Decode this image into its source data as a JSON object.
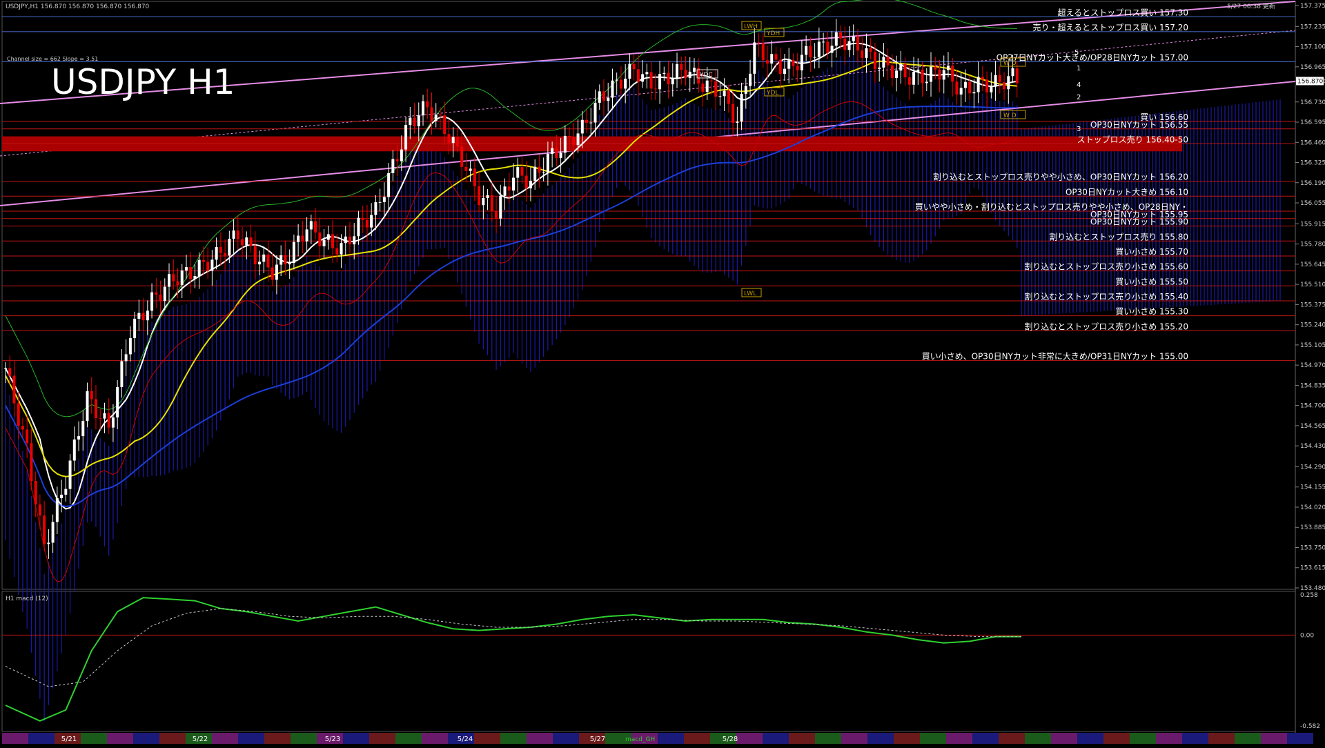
{
  "header": {
    "symbol_info": "USDJPY,H1  156.870 156.870 156.870 156.870",
    "updated": "5/27 06:38 更新",
    "channel_info": "Channel size = 662 Slope = 3.51",
    "big_title": "USDJPY H1",
    "macd_label": "H1  macd (12)",
    "macd_tab": "macd_GH"
  },
  "markers": {
    "lwh": "LWH",
    "lwl": "LWL",
    "ydh": "YDH",
    "ydl": "YDL",
    "ydc": "YDC",
    "wd_top": "W D",
    "wd_bot": "W D",
    "ch1": "1",
    "ch2": "2",
    "ch3": "3",
    "ch4": "4",
    "ch5": "5"
  },
  "chart_data": {
    "type": "candlestick",
    "symbol": "USDJPY",
    "timeframe": "H1",
    "last_price": 156.87,
    "y_axis_ticks": [
      "157.375",
      "157.235",
      "157.100",
      "156.965",
      "156.870",
      "156.730",
      "156.595",
      "156.460",
      "156.325",
      "156.190",
      "156.055",
      "155.915",
      "155.780",
      "155.645",
      "155.510",
      "155.375",
      "155.240",
      "155.105",
      "154.970",
      "154.835",
      "154.700",
      "154.565",
      "154.430",
      "154.290",
      "154.155",
      "154.020",
      "153.885",
      "153.750",
      "153.615",
      "153.480"
    ],
    "ylim": [
      153.48,
      157.375
    ],
    "date_labels": [
      "5/21",
      "5/22",
      "5/23",
      "5/24",
      "5/27",
      "5/28"
    ],
    "levels": [
      {
        "price": 157.3,
        "label": "超えるとストップロス買い 157.30"
      },
      {
        "price": 157.2,
        "label": "売り・超えるとストップロス買い 157.20"
      },
      {
        "price": 157.0,
        "label": "OP27日NYカット大きめ/OP28日NYカット 157.00"
      },
      {
        "price": 156.6,
        "label": "買い 156.60"
      },
      {
        "price": 156.55,
        "label": "OP30日NYカット 156.55"
      },
      {
        "price": 156.45,
        "label": "ストップロス売り 156.40-50"
      },
      {
        "price": 156.2,
        "label": "割り込むとストップロス売りやや小さめ、OP30日NYカット 156.20"
      },
      {
        "price": 156.1,
        "label": "OP30日NYカット大きめ 156.10"
      },
      {
        "price": 156.0,
        "label": "買いやや小さめ・割り込むとストップロス売りやや小さめ、OP28日NY・"
      },
      {
        "price": 155.95,
        "label": "OP30日NYカット 155.95"
      },
      {
        "price": 155.9,
        "label": "OP30日NYカット 155.90"
      },
      {
        "price": 155.8,
        "label": "割り込むとストップロス売り 155.80"
      },
      {
        "price": 155.7,
        "label": "買い小さめ 155.70"
      },
      {
        "price": 155.6,
        "label": "割り込むとストップロス売り小さめ 155.60"
      },
      {
        "price": 155.5,
        "label": "買い小さめ 155.50"
      },
      {
        "price": 155.4,
        "label": "割り込むとストップロス売り小さめ 155.40"
      },
      {
        "price": 155.3,
        "label": "買い小さめ 155.30"
      },
      {
        "price": 155.2,
        "label": "割り込むとストップロス売り小さめ 155.20"
      },
      {
        "price": 155.0,
        "label": "買い小さめ、OP30日NYカット非常に大きめ/OP31日NYカット 155.00"
      }
    ],
    "close_path": [
      [
        0,
        154.95
      ],
      [
        5,
        154.4
      ],
      [
        9,
        153.75
      ],
      [
        14,
        154.2
      ],
      [
        19,
        154.75
      ],
      [
        24,
        154.55
      ],
      [
        29,
        155.2
      ],
      [
        34,
        155.4
      ],
      [
        39,
        155.55
      ],
      [
        44,
        155.6
      ],
      [
        49,
        155.7
      ],
      [
        54,
        155.85
      ],
      [
        58,
        155.7
      ],
      [
        62,
        155.6
      ],
      [
        66,
        155.7
      ],
      [
        70,
        155.9
      ],
      [
        74,
        155.8
      ],
      [
        78,
        155.75
      ],
      [
        82,
        155.9
      ],
      [
        86,
        156.0
      ],
      [
        90,
        156.3
      ],
      [
        94,
        156.6
      ],
      [
        98,
        156.7
      ],
      [
        102,
        156.55
      ],
      [
        106,
        156.35
      ],
      [
        110,
        156.1
      ],
      [
        114,
        156.0
      ],
      [
        118,
        156.25
      ],
      [
        122,
        156.2
      ],
      [
        126,
        156.35
      ],
      [
        130,
        156.45
      ],
      [
        134,
        156.55
      ],
      [
        138,
        156.75
      ],
      [
        142,
        156.85
      ],
      [
        146,
        156.95
      ],
      [
        150,
        156.85
      ],
      [
        154,
        156.9
      ],
      [
        158,
        156.95
      ],
      [
        162,
        156.85
      ],
      [
        166,
        156.8
      ],
      [
        170,
        156.6
      ],
      [
        174,
        157.1
      ],
      [
        178,
        157.0
      ],
      [
        182,
        156.95
      ],
      [
        186,
        157.05
      ],
      [
        190,
        157.1
      ],
      [
        194,
        157.15
      ],
      [
        198,
        157.1
      ],
      [
        202,
        157.0
      ],
      [
        206,
        156.95
      ],
      [
        210,
        156.9
      ],
      [
        214,
        156.9
      ],
      [
        218,
        156.95
      ],
      [
        222,
        156.8
      ],
      [
        226,
        156.85
      ],
      [
        230,
        156.85
      ],
      [
        234,
        156.9
      ],
      [
        236,
        156.87
      ]
    ],
    "macd": {
      "yticks": [
        "0.258",
        "0.00",
        "-0.582"
      ],
      "ylim": [
        -0.582,
        0.258
      ],
      "main": [
        [
          0,
          -0.45
        ],
        [
          8,
          -0.55
        ],
        [
          14,
          -0.48
        ],
        [
          20,
          -0.1
        ],
        [
          26,
          0.15
        ],
        [
          32,
          0.24
        ],
        [
          38,
          0.23
        ],
        [
          44,
          0.22
        ],
        [
          50,
          0.17
        ],
        [
          56,
          0.15
        ],
        [
          62,
          0.12
        ],
        [
          68,
          0.09
        ],
        [
          74,
          0.12
        ],
        [
          80,
          0.15
        ],
        [
          86,
          0.18
        ],
        [
          92,
          0.13
        ],
        [
          98,
          0.08
        ],
        [
          104,
          0.04
        ],
        [
          110,
          0.03
        ],
        [
          116,
          0.04
        ],
        [
          122,
          0.05
        ],
        [
          128,
          0.07
        ],
        [
          134,
          0.1
        ],
        [
          140,
          0.12
        ],
        [
          146,
          0.13
        ],
        [
          152,
          0.11
        ],
        [
          158,
          0.09
        ],
        [
          164,
          0.1
        ],
        [
          170,
          0.1
        ],
        [
          176,
          0.1
        ],
        [
          182,
          0.08
        ],
        [
          188,
          0.07
        ],
        [
          194,
          0.05
        ],
        [
          200,
          0.02
        ],
        [
          206,
          0.0
        ],
        [
          212,
          -0.03
        ],
        [
          218,
          -0.05
        ],
        [
          224,
          -0.04
        ],
        [
          230,
          -0.01
        ],
        [
          236,
          -0.01
        ]
      ],
      "signal": [
        [
          0,
          -0.2
        ],
        [
          10,
          -0.33
        ],
        [
          18,
          -0.3
        ],
        [
          26,
          -0.1
        ],
        [
          34,
          0.06
        ],
        [
          42,
          0.14
        ],
        [
          50,
          0.17
        ],
        [
          58,
          0.15
        ],
        [
          66,
          0.12
        ],
        [
          74,
          0.11
        ],
        [
          82,
          0.12
        ],
        [
          90,
          0.12
        ],
        [
          98,
          0.1
        ],
        [
          106,
          0.07
        ],
        [
          114,
          0.05
        ],
        [
          122,
          0.05
        ],
        [
          130,
          0.06
        ],
        [
          138,
          0.08
        ],
        [
          146,
          0.1
        ],
        [
          154,
          0.1
        ],
        [
          162,
          0.09
        ],
        [
          170,
          0.09
        ],
        [
          178,
          0.08
        ],
        [
          186,
          0.07
        ],
        [
          194,
          0.06
        ],
        [
          202,
          0.04
        ],
        [
          210,
          0.02
        ],
        [
          218,
          0.0
        ],
        [
          226,
          -0.01
        ],
        [
          236,
          -0.01
        ]
      ]
    }
  }
}
